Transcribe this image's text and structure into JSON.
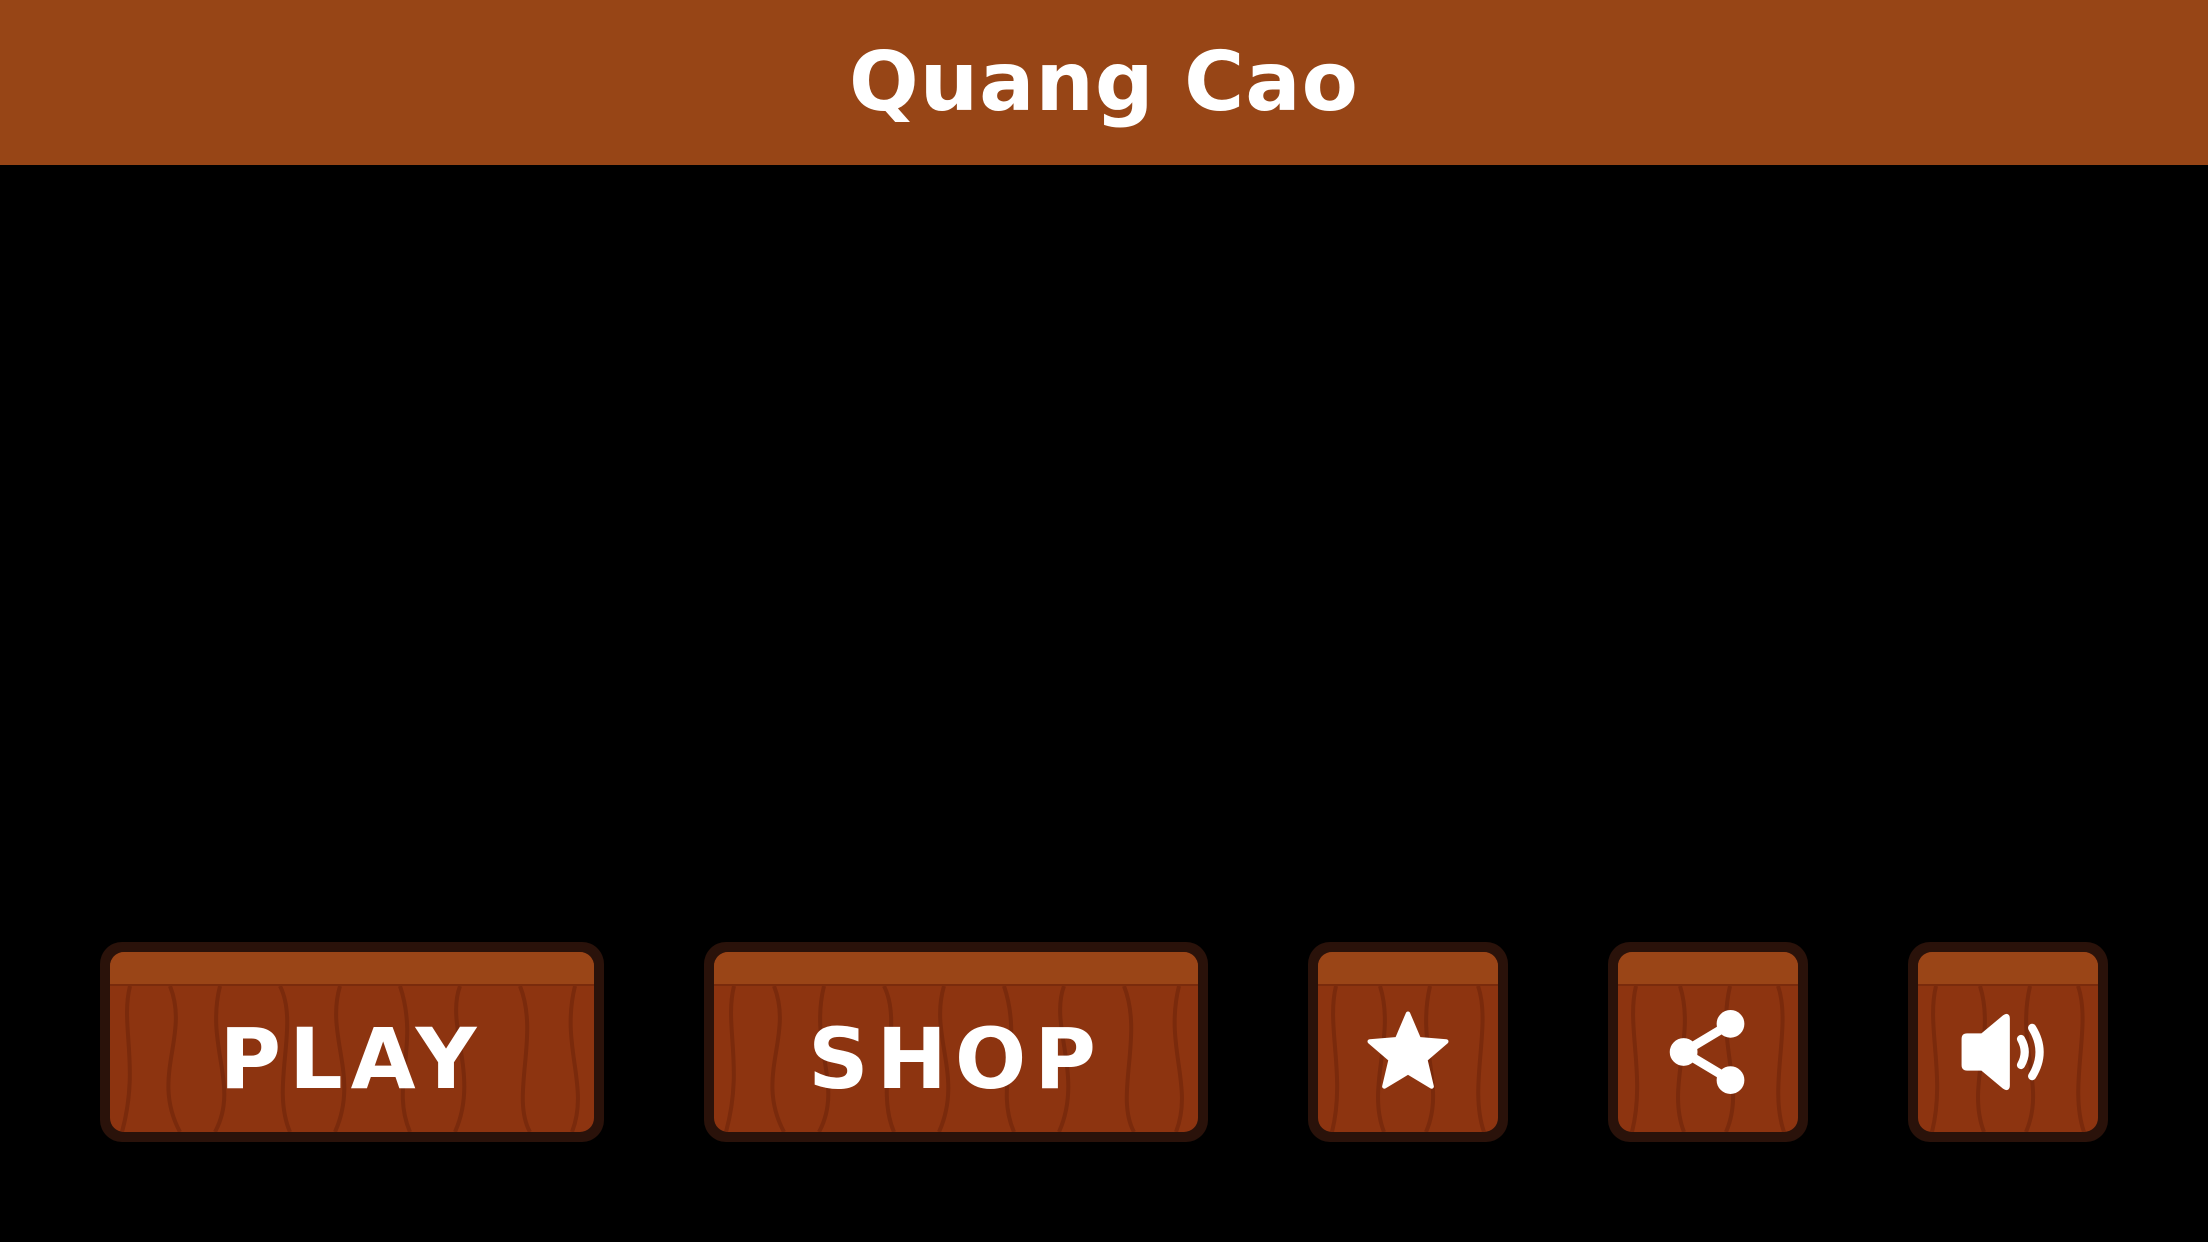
{
  "ad_banner": {
    "title": "Quang Cao",
    "color": "#974516"
  },
  "buttons": {
    "play": {
      "label": "PLAY"
    },
    "shop": {
      "label": "SHOP"
    },
    "rate": {
      "icon": "star-icon"
    },
    "share": {
      "icon": "share-icon"
    },
    "sound": {
      "icon": "speaker-icon"
    }
  },
  "colors": {
    "background": "#000000",
    "wood": "#8d3410",
    "wood_highlight": "#9a4517",
    "button_border": "#2a120a",
    "text": "#ffffff"
  }
}
